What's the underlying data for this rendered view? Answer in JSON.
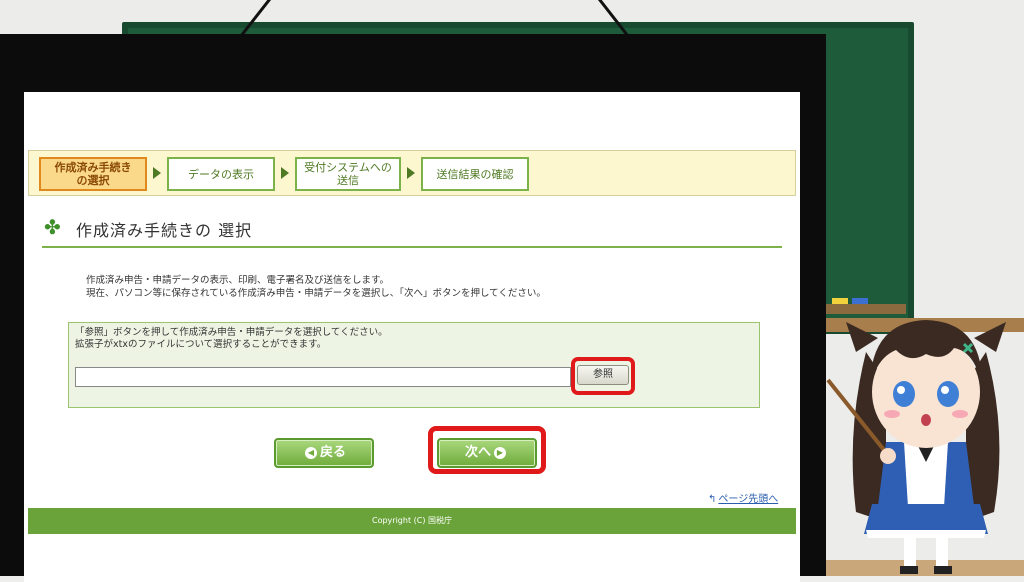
{
  "steps": [
    {
      "label": "作成済み手続き\nの選択",
      "active": true
    },
    {
      "label": "データの表示",
      "active": false
    },
    {
      "label": "受付システムへの\n送信",
      "active": false
    },
    {
      "label": "送信結果の確認",
      "active": false
    }
  ],
  "page": {
    "title": "作成済み手続きの 選択",
    "description": "作成済み申告・申請データの表示、印刷、電子署名及び送信をします。\n現在、パソコン等に保存されている作成済み申告・申請データを選択し、「次へ」ボタンを押してください。"
  },
  "file_select": {
    "instruction": "「参照」ボタンを押して作成済み申告・申請データを選択してください。\n拡張子がxtxのファイルについて選択することができます。",
    "input_value": "",
    "browse_label": "参照"
  },
  "nav": {
    "back_label": "戻る",
    "next_label": "次へ"
  },
  "links": {
    "page_top": "ページ先頭へ"
  },
  "footer": {
    "copyright": "Copyright (C) 国税庁"
  },
  "colors": {
    "accent_green": "#6aa33a",
    "highlight_red": "#e01a1a",
    "active_step": "#fbd98a"
  }
}
